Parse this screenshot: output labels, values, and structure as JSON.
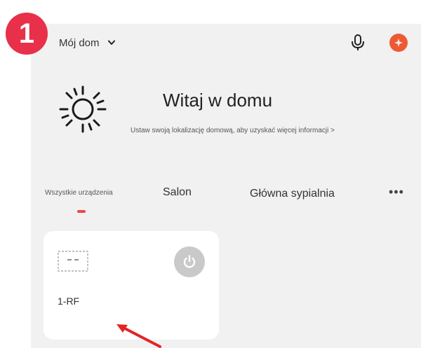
{
  "step_badge": "1",
  "header": {
    "home_name": "Mój dom",
    "icons": [
      "chevron-down-icon",
      "microphone-icon",
      "avatar-icon"
    ]
  },
  "weather": {
    "icon": "sun-icon",
    "greeting": "Witaj w domu",
    "location_prompt": "Ustaw swoją lokalizację domową, aby uzyskać więcej informacji >"
  },
  "tabs": {
    "all": "Wszystkie urządzenia",
    "salon": "Salon",
    "bedroom": "Główna sypialnia",
    "more": "•••"
  },
  "device": {
    "name": "1-RF",
    "icons": [
      "device-icon",
      "power-icon"
    ]
  },
  "colors": {
    "accent": "#ec4a3a",
    "badge": "#e8304a",
    "avatar": "#ec5a35",
    "panel": "#f1f1f1",
    "card": "#ffffff"
  }
}
